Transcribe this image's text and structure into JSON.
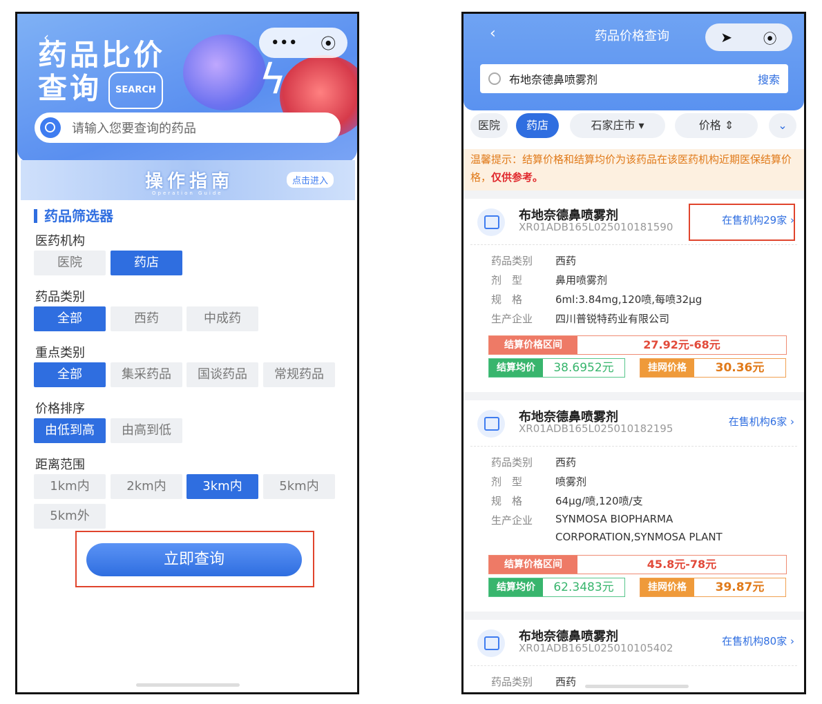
{
  "left": {
    "header": {
      "title_line1": "药品比价",
      "title_line2": "查询",
      "search_badge": "SEARCH",
      "capsule_more": "•••",
      "capsule_close": "⦿",
      "search_placeholder": "请输入您要查询的药品"
    },
    "guide": {
      "title": "操作指南",
      "subtitle": "Operation Guide",
      "enter": "点击进入"
    },
    "filter_title": "药品筛选器",
    "groups": {
      "institution": {
        "label": "医药机构",
        "options": [
          "医院",
          "药店"
        ]
      },
      "category": {
        "label": "药品类别",
        "options": [
          "全部",
          "西药",
          "中成药"
        ]
      },
      "key_type": {
        "label": "重点类别",
        "options": [
          "全部",
          "集采药品",
          "国谈药品",
          "常规药品"
        ]
      },
      "sort": {
        "label": "价格排序",
        "options": [
          "由低到高",
          "由高到低"
        ]
      },
      "distance": {
        "label": "距离范围",
        "options": [
          "1km内",
          "2km内",
          "3km内",
          "5km内",
          "5km外"
        ]
      }
    },
    "query_button": "立即查询"
  },
  "right": {
    "nav": {
      "back": "‹",
      "title": "药品价格查询",
      "location": "➤",
      "close": "⦿"
    },
    "search": {
      "value": "布地奈德鼻喷雾剂",
      "button": "搜索"
    },
    "filters": {
      "hospital": "医院",
      "pharmacy": "药店",
      "city": "石家庄市 ▾",
      "price": "价格 ⇕",
      "more": "⌄"
    },
    "tip_prefix": "温馨提示：结算价格和结算均价为该药品在该医药机构近期医保结算价格，",
    "tip_emph": "仅供参考。",
    "labels": {
      "category": "药品类别",
      "form": "剂　型",
      "spec": "规　格",
      "maker": "生产企业",
      "range": "结算价格区间",
      "avg": "结算均价",
      "net": "挂网价格"
    },
    "cards": [
      {
        "name": "布地奈德鼻喷雾剂",
        "code": "XR01ADB165L025010181590",
        "link": "在售机构29家 ›",
        "category": "西药",
        "form": "鼻用喷雾剂",
        "spec": "6ml:3.84mg,120喷,每喷32μg",
        "maker": "四川普锐特药业有限公司",
        "maker2": "",
        "range": "27.92元-68元",
        "avg": "38.6952元",
        "net": "30.36元"
      },
      {
        "name": "布地奈德鼻喷雾剂",
        "code": "XR01ADB165L025010182195",
        "link": "在售机构6家 ›",
        "category": "西药",
        "form": "喷雾剂",
        "spec": "64μg/喷,120喷/支",
        "maker": "SYNMOSA BIOPHARMA",
        "maker2": "CORPORATION,SYNMOSA PLANT",
        "range": "45.8元-78元",
        "avg": "62.3483元",
        "net": "39.87元"
      },
      {
        "name": "布地奈德鼻喷雾剂",
        "code": "XR01ADB165L025010105402",
        "link": "在售机构80家 ›",
        "category": "西药"
      }
    ]
  }
}
